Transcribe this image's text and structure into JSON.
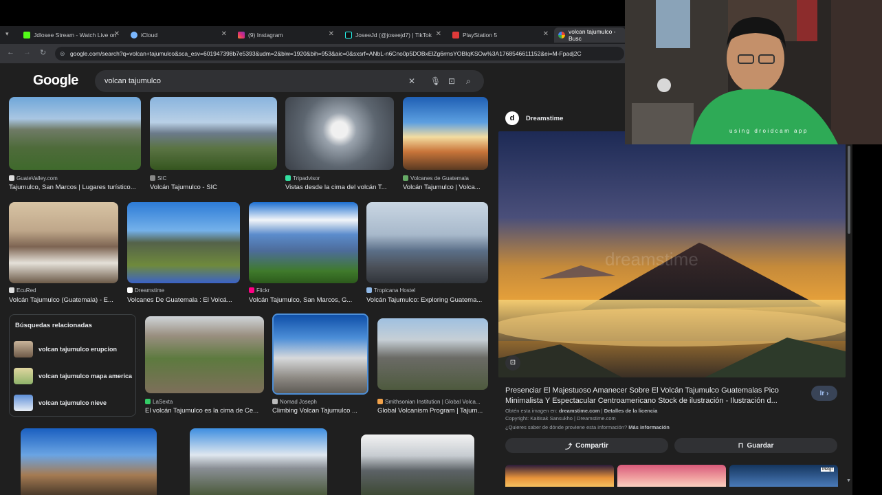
{
  "browser": {
    "tabs": [
      {
        "label": "Jdlosee Stream - Watch Live on",
        "color": "#53fc18"
      },
      {
        "label": "iCloud",
        "color": "#7ab7ff"
      },
      {
        "label": "(9) Instagram",
        "color": "#e1306c"
      },
      {
        "label": "JoseeJd (@joseejd7) | TikTok",
        "color": "#111111"
      },
      {
        "label": "PlayStation 5",
        "color": "#e03a3a"
      },
      {
        "label": "volcan tajumulco - Busc",
        "color": "#4285f4"
      }
    ],
    "url": "google.com/search?q=volcan+tajumulco&sca_esv=601947398b7e5393&udm=2&biw=1920&bih=953&aic=0&sxsrf=ANbL-n6Cno0p5DOBxElZg6rmsYOBIqKSOw%3A1768546611152&ei=M-Fpadj2C"
  },
  "google": {
    "logo": "Google",
    "query": "volcan tajumulco"
  },
  "results": [
    {
      "source": "GuateValley.com",
      "caption": "Tajumulco, San Marcos | Lugares turístico...",
      "src_color": "#dddddd"
    },
    {
      "source": "SIC",
      "caption": "Volcán Tajumulco - SIC",
      "src_color": "#888888"
    },
    {
      "source": "Tripadvisor",
      "caption": "Vistas desde la cima del volcán T...",
      "src_color": "#34e0a1"
    },
    {
      "source": "Volcanes de Guatemala",
      "caption": "Volcán Tajumulco | Volca...",
      "src_color": "#66aa66"
    },
    {
      "source": "EcuRed",
      "caption": "Volcán Tajumulco (Guatemala) - E...",
      "src_color": "#dddddd"
    },
    {
      "source": "Dreamstime",
      "caption": "Volcanes De Guatemala : El Volcá...",
      "src_color": "#ffffff"
    },
    {
      "source": "Flickr",
      "caption": "Volcán Tajumulco, San Marcos, G...",
      "src_color": "#ff0084"
    },
    {
      "source": "Tropicana Hostel",
      "caption": "Volcán Tajumulco: Exploring Guatema...",
      "src_color": "#8fb8e6"
    },
    {
      "source": "LaSexta",
      "caption": "El volcán Tajumulco es la cima de Ce...",
      "src_color": "#33cc66"
    },
    {
      "source": "Nomad Joseph",
      "caption": "Climbing Volcan Tajumulco ...",
      "src_color": "#bbbbbb"
    },
    {
      "source": "Smithsonian Institution | Global Volca...",
      "caption": "Global Volcanism Program | Tajum...",
      "src_color": "#f2a24a"
    }
  ],
  "related": {
    "title": "Búsquedas relacionadas",
    "items": [
      "volcan tajumulco erupcion",
      "volcan tajumulco mapa america",
      "volcan tajumulco nieve"
    ]
  },
  "panel": {
    "site": "Dreamstime",
    "watermark": "dreamstime",
    "title": "Presenciar El Majestuoso Amanecer Sobre El Volcán Tajumulco Guatemalas Pico Minimalista Y Espectacular Centroamericano Stock de ilustración - Ilustración d...",
    "obtain_prefix": "Obtén esta imagen en:",
    "obtain_site": "dreamstime.com",
    "obtain_sep": " | ",
    "license": "Detalles de la licencia",
    "copyright": "Copyright: Kaitisak Sansukho | Dreamstime.com",
    "question": "¿Quieres saber de dónde proviene esta información?",
    "more_info": "Más información",
    "go_button": "Ir",
    "share": "Compartir",
    "save": "Guardar",
    "thumb_badge": "Metgf"
  },
  "webcam": {
    "overlay": "using droidcam app"
  }
}
